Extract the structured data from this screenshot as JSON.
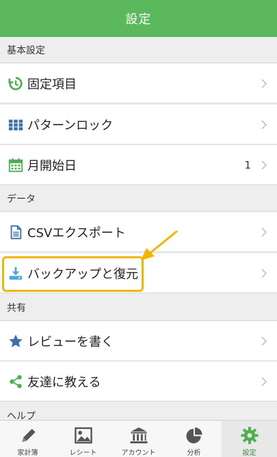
{
  "header": {
    "title": "設定"
  },
  "sections": {
    "basic": {
      "title": "基本設定"
    },
    "data": {
      "title": "データ"
    },
    "share": {
      "title": "共有"
    },
    "help": {
      "title": "ヘルプ"
    }
  },
  "rows": {
    "fixed_items": {
      "label": "固定項目",
      "icon": "history-icon"
    },
    "pattern_lock": {
      "label": "パターンロック",
      "icon": "grid-icon"
    },
    "month_start": {
      "label": "月開始日",
      "value": "1",
      "icon": "calendar-icon"
    },
    "csv_export": {
      "label": "CSVエクスポート",
      "icon": "document-icon"
    },
    "backup_restore": {
      "label": "バックアップと復元",
      "icon": "download-icon"
    },
    "write_review": {
      "label": "レビューを書く",
      "icon": "star-icon"
    },
    "tell_friends": {
      "label": "友達に教える",
      "icon": "share-icon"
    }
  },
  "tabs": [
    {
      "label": "家計簿",
      "icon": "pencil-icon"
    },
    {
      "label": "レシート",
      "icon": "image-icon"
    },
    {
      "label": "アカウント",
      "icon": "bank-icon"
    },
    {
      "label": "分析",
      "icon": "pie-chart-icon"
    },
    {
      "label": "設定",
      "icon": "gear-icon",
      "active": true
    }
  ],
  "colors": {
    "accent": "#5cb85c",
    "highlight": "#f5b400",
    "icon_blue": "#3a6fb0"
  }
}
